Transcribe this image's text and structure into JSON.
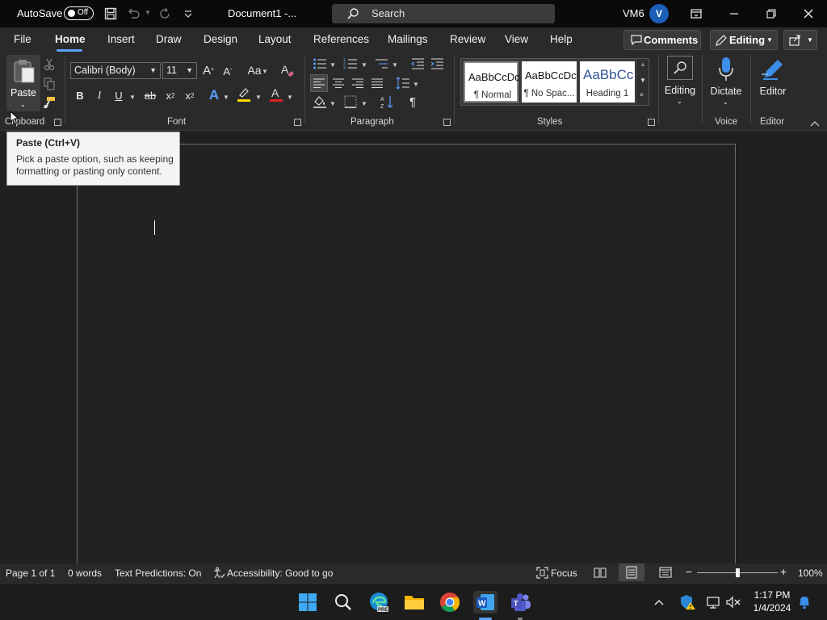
{
  "titlebar": {
    "autosave_label": "AutoSave",
    "autosave_state": "Off",
    "document_title": "Document1  -...",
    "search_placeholder": "Search",
    "user_name": "VM6",
    "user_initial": "V"
  },
  "menu": {
    "tabs": [
      "File",
      "Home",
      "Insert",
      "Draw",
      "Design",
      "Layout",
      "References",
      "Mailings",
      "Review",
      "View",
      "Help"
    ],
    "active_tab": "Home",
    "comments_label": "Comments",
    "editing_label": "Editing"
  },
  "ribbon": {
    "clipboard": {
      "paste_label": "Paste",
      "group_label": "Clipboard"
    },
    "font": {
      "font_name": "Calibri (Body)",
      "font_size": "11",
      "change_case": "Aa",
      "group_label": "Font"
    },
    "paragraph": {
      "group_label": "Paragraph"
    },
    "styles": {
      "group_label": "Styles",
      "items": [
        {
          "sample": "AaBbCcDc",
          "name": "¶ Normal"
        },
        {
          "sample": "AaBbCcDc",
          "name": "¶ No Spac..."
        },
        {
          "sample": "AaBbCc",
          "name": "Heading 1"
        }
      ]
    },
    "editing": {
      "label": "Editing"
    },
    "voice": {
      "dictate_label": "Dictate",
      "group_label": "Voice"
    },
    "editor": {
      "label": "Editor",
      "group_label": "Editor"
    }
  },
  "tooltip": {
    "title": "Paste (Ctrl+V)",
    "body": "Pick a paste option, such as keeping formatting or pasting only content."
  },
  "statusbar": {
    "page": "Page 1 of 1",
    "words": "0 words",
    "text_predictions": "Text Predictions: On",
    "accessibility": "Accessibility: Good to go",
    "focus": "Focus",
    "zoom": "100%",
    "zoom_level": 1.0
  },
  "taskbar": {
    "time": "1:17 PM",
    "date": "1/4/2024",
    "apps": [
      "start-icon",
      "search-icon",
      "edge-icon",
      "file-explorer-icon",
      "chrome-icon",
      "word-icon",
      "teams-icon"
    ]
  },
  "colors": {
    "accent": "#5aa0ff",
    "avatar": "#1b5fb9",
    "highlight": "#ffd700",
    "font_color": "#e02020"
  }
}
